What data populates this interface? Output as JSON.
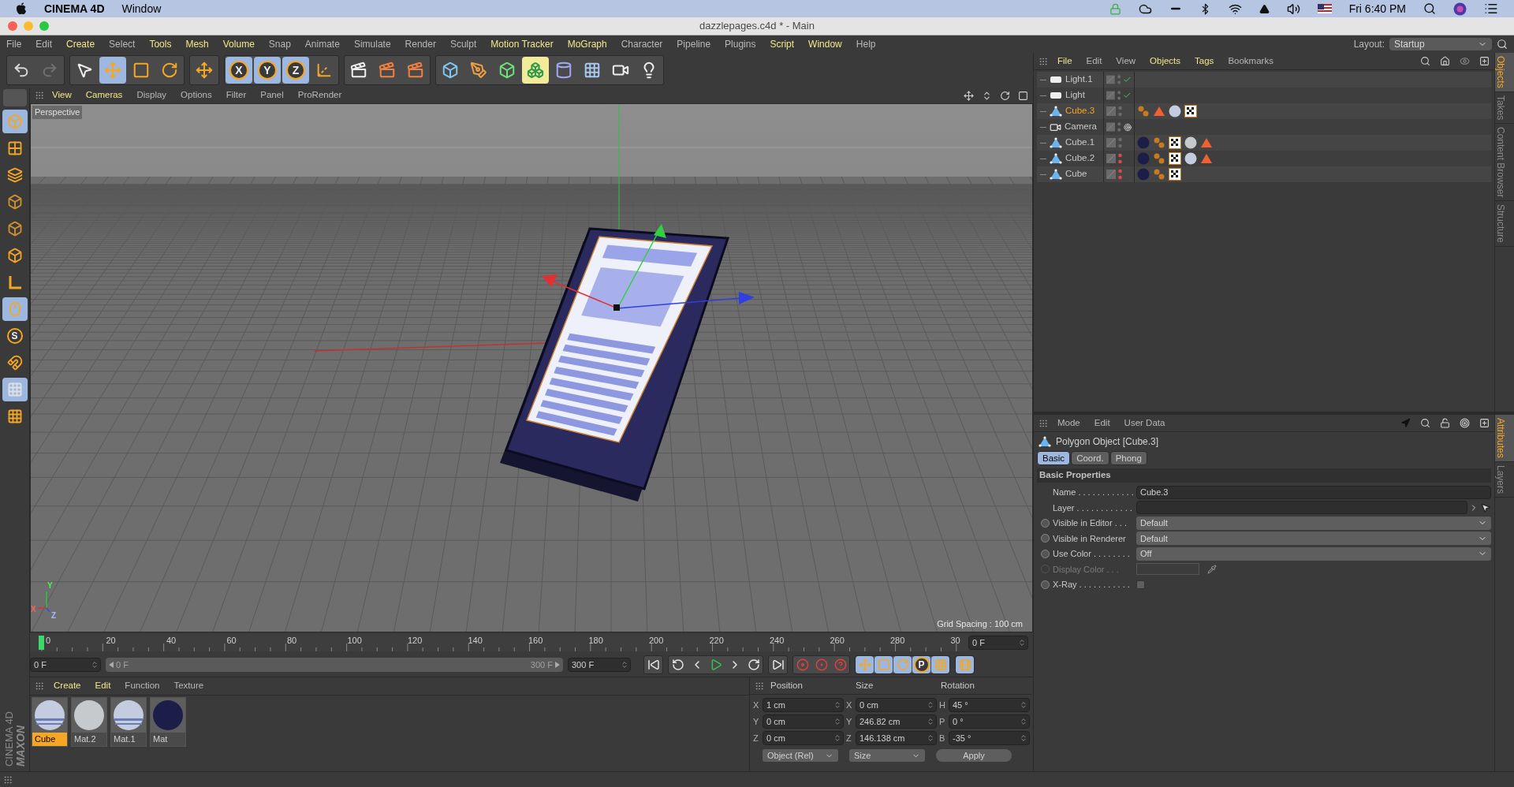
{
  "mac_menubar": {
    "app": "CINEMA 4D",
    "menus": [
      "Window"
    ],
    "clock": "Fri 6:40 PM"
  },
  "window": {
    "title": "dazzlepages.c4d * - Main"
  },
  "menu": {
    "items": [
      {
        "label": "File",
        "highlight": false
      },
      {
        "label": "Edit",
        "highlight": false
      },
      {
        "label": "Create",
        "highlight": true
      },
      {
        "label": "Select",
        "highlight": false
      },
      {
        "label": "Tools",
        "highlight": true
      },
      {
        "label": "Mesh",
        "highlight": true
      },
      {
        "label": "Volume",
        "highlight": true
      },
      {
        "label": "Snap",
        "highlight": false
      },
      {
        "label": "Animate",
        "highlight": false
      },
      {
        "label": "Simulate",
        "highlight": false
      },
      {
        "label": "Render",
        "highlight": false
      },
      {
        "label": "Sculpt",
        "highlight": false
      },
      {
        "label": "Motion Tracker",
        "highlight": true
      },
      {
        "label": "MoGraph",
        "highlight": true
      },
      {
        "label": "Character",
        "highlight": false
      },
      {
        "label": "Pipeline",
        "highlight": false
      },
      {
        "label": "Plugins",
        "highlight": false
      },
      {
        "label": "Script",
        "highlight": true
      },
      {
        "label": "Window",
        "highlight": true
      },
      {
        "label": "Help",
        "highlight": false
      }
    ],
    "layout_label": "Layout:",
    "layout_value": "Startup"
  },
  "toolbar": [
    [
      {
        "kind": "undo",
        "selected": false
      },
      {
        "kind": "redo",
        "selected": false
      }
    ],
    [
      {
        "kind": "select",
        "selected": false
      },
      {
        "kind": "move",
        "selected": true
      },
      {
        "kind": "scale",
        "selected": false
      },
      {
        "kind": "rotate",
        "selected": false
      }
    ],
    [
      {
        "kind": "move",
        "selected": false
      }
    ],
    [
      {
        "kind": "axis",
        "label": "X",
        "selected": true
      },
      {
        "kind": "axis",
        "label": "Y",
        "selected": true
      },
      {
        "kind": "axis",
        "label": "Z",
        "selected": true
      },
      {
        "kind": "coords",
        "selected": false
      }
    ],
    [
      {
        "kind": "render-view",
        "selected": false
      },
      {
        "kind": "render-picture",
        "selected": false
      },
      {
        "kind": "render-settings",
        "selected": false
      }
    ],
    [
      {
        "kind": "cube",
        "selected": false
      },
      {
        "kind": "pen",
        "selected": false
      },
      {
        "kind": "subdivision",
        "selected": false
      },
      {
        "kind": "cloner",
        "selected": true
      },
      {
        "kind": "deformer",
        "selected": false
      },
      {
        "kind": "floor",
        "selected": false
      },
      {
        "kind": "camera",
        "selected": false
      },
      {
        "kind": "light",
        "selected": false
      }
    ]
  ],
  "left_toolbar": [
    {
      "kind": "model",
      "selected": true
    },
    {
      "kind": "texture",
      "selected": false
    },
    {
      "kind": "workplane",
      "selected": false
    },
    {
      "kind": "points",
      "selected": false
    },
    {
      "kind": "edges",
      "selected": false
    },
    {
      "kind": "polygons",
      "selected": false
    },
    {
      "kind": "axis-mode",
      "selected": false
    },
    {
      "kind": "tweak",
      "selected": true
    },
    {
      "kind": "snap",
      "label": "S",
      "selected": false
    },
    {
      "kind": "magnet",
      "selected": false
    },
    {
      "kind": "grid-snap",
      "selected": true
    },
    {
      "kind": "grid-lock",
      "selected": false
    }
  ],
  "logo": [
    "MAXON",
    "CINEMA 4D"
  ],
  "viewport": {
    "menu": [
      {
        "label": "View",
        "highlight": true
      },
      {
        "label": "Cameras",
        "highlight": true
      },
      {
        "label": "Display",
        "highlight": false
      },
      {
        "label": "Options",
        "highlight": false
      },
      {
        "label": "Filter",
        "highlight": false
      },
      {
        "label": "Panel",
        "highlight": false
      },
      {
        "label": "ProRender",
        "highlight": false
      }
    ],
    "camera": "Perspective",
    "grid_spacing": "Grid Spacing : 100 cm",
    "axis_labels": [
      "Y",
      "X",
      "Z"
    ]
  },
  "timeline": {
    "labels": [
      "0",
      "20",
      "40",
      "60",
      "80",
      "100",
      "120",
      "140",
      "160",
      "180",
      "200",
      "220",
      "240",
      "260",
      "280",
      "30"
    ],
    "playhead": {
      "level": 0
    },
    "frame_field": "0 F"
  },
  "playback": {
    "start_field": "0 F",
    "range_start": "0 F",
    "range_end": "300 F",
    "range_slider": {
      "level": 1
    },
    "end_field": "300 F",
    "buttons": [
      [
        {
          "kind": "to-start",
          "selected": false
        }
      ],
      [
        {
          "kind": "prev-key",
          "selected": false
        },
        {
          "kind": "prev-frame",
          "selected": false
        },
        {
          "kind": "play",
          "selected": false
        },
        {
          "kind": "next-frame",
          "selected": false
        },
        {
          "kind": "next-key",
          "selected": false
        }
      ],
      [
        {
          "kind": "to-end",
          "selected": false
        }
      ],
      [
        {
          "kind": "record",
          "selected": false
        },
        {
          "kind": "autokey",
          "selected": false
        },
        {
          "kind": "key-help",
          "selected": false
        }
      ],
      [
        {
          "kind": "pos-key",
          "selected": true
        },
        {
          "kind": "scale-key",
          "selected": true
        },
        {
          "kind": "rot-key",
          "selected": true
        },
        {
          "kind": "param-key",
          "label": "P",
          "selected": true
        },
        {
          "kind": "pla-key",
          "selected": true
        }
      ],
      [
        {
          "kind": "timeline",
          "selected": true
        }
      ]
    ]
  },
  "materials": {
    "menu": [
      {
        "label": "Create",
        "highlight": true
      },
      {
        "label": "Edit",
        "highlight": true
      },
      {
        "label": "Function",
        "highlight": false
      },
      {
        "label": "Texture",
        "highlight": false
      }
    ],
    "items": [
      {
        "name": "Cube",
        "kind": "striped",
        "color": "#c4cce0",
        "selected": true
      },
      {
        "name": "Mat.2",
        "kind": "plain",
        "color": "#c6cacc",
        "selected": false
      },
      {
        "name": "Mat.1",
        "kind": "striped",
        "color": "#c4cce0",
        "selected": false
      },
      {
        "name": "Mat",
        "kind": "plain",
        "color": "#1c1d48",
        "selected": false
      }
    ]
  },
  "coordinates": {
    "columns": [
      "Position",
      "Size",
      "Rotation"
    ],
    "rows": [
      [
        {
          "axis": "X",
          "value": "1 cm"
        },
        {
          "axis": "X",
          "value": "0 cm"
        },
        {
          "axis": "H",
          "value": "45 °"
        }
      ],
      [
        {
          "axis": "Y",
          "value": "0 cm"
        },
        {
          "axis": "Y",
          "value": "246.82 cm"
        },
        {
          "axis": "P",
          "value": "0 °"
        }
      ],
      [
        {
          "axis": "Z",
          "value": "0 cm"
        },
        {
          "axis": "Z",
          "value": "146.138 cm"
        },
        {
          "axis": "B",
          "value": "-35 °"
        }
      ]
    ],
    "dropdowns": [
      "Object (Rel)",
      "Size"
    ],
    "apply": "Apply"
  },
  "objects": {
    "menu": [
      {
        "label": "File",
        "highlight": true
      },
      {
        "label": "Edit",
        "highlight": false
      },
      {
        "label": "View",
        "highlight": false
      },
      {
        "label": "Objects",
        "highlight": true
      },
      {
        "label": "Tags",
        "highlight": true
      },
      {
        "label": "Bookmarks",
        "highlight": false
      }
    ],
    "rows": [
      {
        "name": "Light.1",
        "kind": "light",
        "selected": false,
        "hidden": false,
        "tags": []
      },
      {
        "name": "Light",
        "kind": "light",
        "selected": false,
        "hidden": false,
        "tags": []
      },
      {
        "name": "Cube.3",
        "kind": "polygon",
        "selected": true,
        "hidden": false,
        "tags": [
          {
            "kind": "phong"
          },
          {
            "kind": "selection"
          },
          {
            "kind": "material",
            "color": "#c4cce0"
          },
          {
            "kind": "uvw"
          }
        ]
      },
      {
        "name": "Camera",
        "kind": "camera",
        "selected": false,
        "hidden": false,
        "tags": []
      },
      {
        "name": "Cube.1",
        "kind": "polygon",
        "selected": false,
        "hidden": false,
        "tags": [
          {
            "kind": "material",
            "color": "#1c1d48"
          },
          {
            "kind": "phong"
          },
          {
            "kind": "uvw"
          },
          {
            "kind": "material",
            "color": "#c6cacc"
          },
          {
            "kind": "selection"
          }
        ]
      },
      {
        "name": "Cube.2",
        "kind": "polygon",
        "selected": false,
        "hidden": true,
        "tags": [
          {
            "kind": "material",
            "color": "#1c1d48"
          },
          {
            "kind": "phong"
          },
          {
            "kind": "uvw"
          },
          {
            "kind": "material",
            "color": "#c4cce0"
          },
          {
            "kind": "selection"
          }
        ]
      },
      {
        "name": "Cube",
        "kind": "polygon",
        "selected": false,
        "hidden": true,
        "tags": [
          {
            "kind": "material",
            "color": "#1c1d48"
          },
          {
            "kind": "phong"
          },
          {
            "kind": "uvw"
          }
        ]
      }
    ],
    "side_tabs": [
      {
        "label": "Objects",
        "selected": true
      },
      {
        "label": "Takes",
        "selected": false
      },
      {
        "label": "Content Browser",
        "selected": false
      },
      {
        "label": "Structure",
        "selected": false
      }
    ]
  },
  "attributes": {
    "menu": [
      {
        "label": "Mode",
        "highlight": false
      },
      {
        "label": "Edit",
        "highlight": false
      },
      {
        "label": "User Data",
        "highlight": false
      }
    ],
    "title": "Polygon Object [Cube.3]",
    "tabs": [
      {
        "label": "Basic",
        "selected": true
      },
      {
        "label": "Coord.",
        "selected": false
      },
      {
        "label": "Phong",
        "selected": false
      }
    ],
    "section": "Basic Properties",
    "properties": [
      {
        "kind": "text",
        "label": "Name . . . . . . . . . . . .",
        "value": "Cube.3",
        "animatable": false,
        "disabled": false
      },
      {
        "kind": "link",
        "label": "Layer . . . . . . . . . . . .",
        "animatable": false,
        "disabled": false
      },
      {
        "kind": "select",
        "label": "Visible in Editor . . .",
        "value": "Default",
        "animatable": true,
        "disabled": false
      },
      {
        "kind": "select",
        "label": "Visible in Renderer",
        "value": "Default",
        "animatable": true,
        "disabled": false
      },
      {
        "kind": "select",
        "label": "Use Color . . . . . . . .",
        "value": "Off",
        "animatable": true,
        "disabled": false
      },
      {
        "kind": "color",
        "label": "Display Color . . .",
        "animatable": true,
        "disabled": true
      },
      {
        "kind": "checkbox",
        "label": "X-Ray . . . . . . . . . . .",
        "checked": false,
        "animatable": true,
        "disabled": false
      }
    ],
    "side_tabs": [
      {
        "label": "Attributes",
        "selected": true
      },
      {
        "label": "Layers",
        "selected": false
      }
    ]
  }
}
